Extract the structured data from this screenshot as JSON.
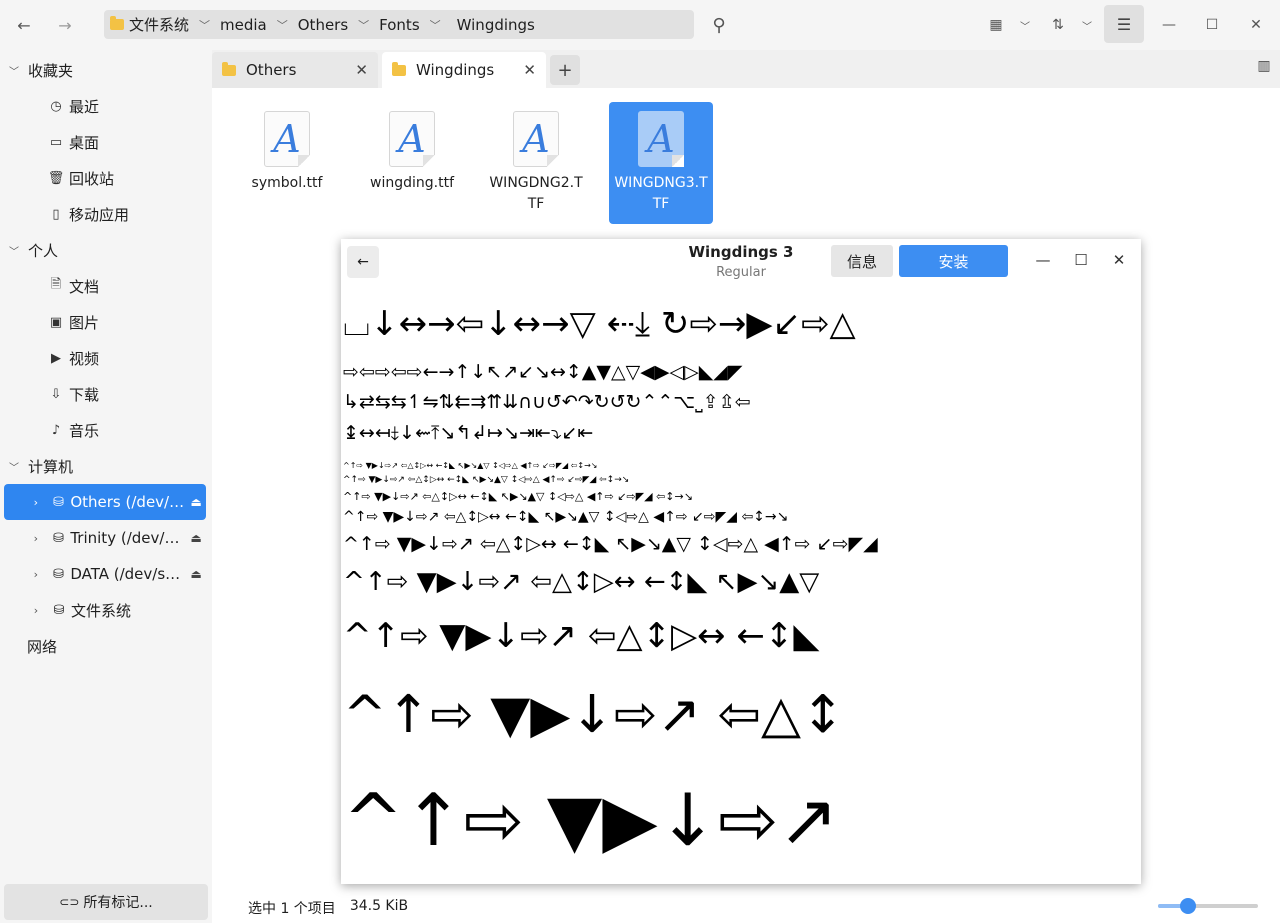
{
  "toolbar": {
    "back_icon": "←",
    "forward_icon": "→",
    "breadcrumb": [
      "文件系统",
      "media",
      "Others",
      "Fonts",
      "Wingdings"
    ],
    "search_icon": "⚲",
    "view_icon": "▦",
    "sort_icon": "⇅",
    "menu_icon": "☰",
    "minimize_icon": "—",
    "maximize_icon": "☐",
    "close_icon": "✕"
  },
  "sidebar": {
    "favorites": {
      "label": "收藏夹",
      "items": [
        {
          "label": "最近",
          "icon": "◷"
        },
        {
          "label": "桌面",
          "icon": "▭"
        },
        {
          "label": "回收站",
          "icon": "🗑"
        },
        {
          "label": "移动应用",
          "icon": "▯"
        }
      ]
    },
    "personal": {
      "label": "个人",
      "items": [
        {
          "label": "文档",
          "icon": "🗎"
        },
        {
          "label": "图片",
          "icon": "▣"
        },
        {
          "label": "视频",
          "icon": "▶"
        },
        {
          "label": "下载",
          "icon": "⇩"
        },
        {
          "label": "音乐",
          "icon": "♪"
        }
      ]
    },
    "computer": {
      "label": "计算机",
      "devices": [
        {
          "label": "Others (/dev/sda1)",
          "selected": true
        },
        {
          "label": "Trinity (/dev/sdb1)"
        },
        {
          "label": "DATA (/dev/sdc1)"
        },
        {
          "label": "文件系统"
        }
      ]
    },
    "network": {
      "label": "网络"
    },
    "tags_button": "所有标记..."
  },
  "tabs": [
    {
      "label": "Others"
    },
    {
      "label": "Wingdings"
    }
  ],
  "files": [
    {
      "name": "symbol.ttf"
    },
    {
      "name": "wingding.ttf"
    },
    {
      "name": "WINGDNG2.TTF"
    },
    {
      "name": "WINGDNG3.TTF",
      "selected": true
    }
  ],
  "status": {
    "selection": "选中 1 个项目",
    "size": "34.5 KiB"
  },
  "zoom_level": 0.3,
  "dialog": {
    "title": "Wingdings 3",
    "subtitle": "Regular",
    "info_button": "信息",
    "install_button": "安装",
    "samples": [
      "⌴↓↔→⇦↓↔→▽  ⇠⤓  ↻⇨→▶↙⇨△",
      "⇨⇦⇨⇦⇨←→↑↓↖↗↙↘↔↕▲▼△▽◀▶◁▷◣◢◤",
      "↳⇄⇆⇆↿⇋⇅⇇⇉⇈⇊∩∪↺↶↷↻↺↻⌃⌃⌥⎵⇪⇫⇦",
      "↨↔↤⤈↓⇜⤒↘↰↲↦↘⇥⇤⤵↙⇤",
      "^↑⇨ ▼▶↓⇨↗ ⇦△↕▷↔ ←↕◣ ↖▶↘▲▽ ↕◁⇨△ ◀↑⇨ ↙⇨◤◢ ⇦↕→↘",
      "^↑⇨ ▼▶↓⇨↗ ⇦△↕▷↔ ←↕◣ ↖▶↘▲▽ ↕◁⇨△ ◀↑⇨ ↙⇨◤◢ ⇦↕→↘",
      "^↑⇨ ▼▶↓⇨↗ ⇦△↕▷↔ ←↕◣ ↖▶↘▲▽ ↕◁⇨△ ◀↑⇨ ↙⇨◤◢ ⇦↕→↘",
      "^↑⇨ ▼▶↓⇨↗ ⇦△↕▷↔ ←↕◣ ↖▶↘▲▽ ↕◁⇨△ ◀↑⇨ ↙⇨◤◢ ⇦↕→↘",
      "^↑⇨ ▼▶↓⇨↗ ⇦△↕▷↔ ←↕◣ ↖▶↘▲▽ ↕◁⇨△ ◀↑⇨ ↙⇨◤◢",
      "^↑⇨ ▼▶↓⇨↗ ⇦△↕▷↔ ←↕◣ ↖▶↘▲▽",
      "^↑⇨ ▼▶↓⇨↗ ⇦△↕▷↔ ←↕◣",
      "^↑⇨ ▼▶↓⇨↗ ⇦△↕",
      "^↑⇨ ▼▶↓⇨↗"
    ]
  }
}
